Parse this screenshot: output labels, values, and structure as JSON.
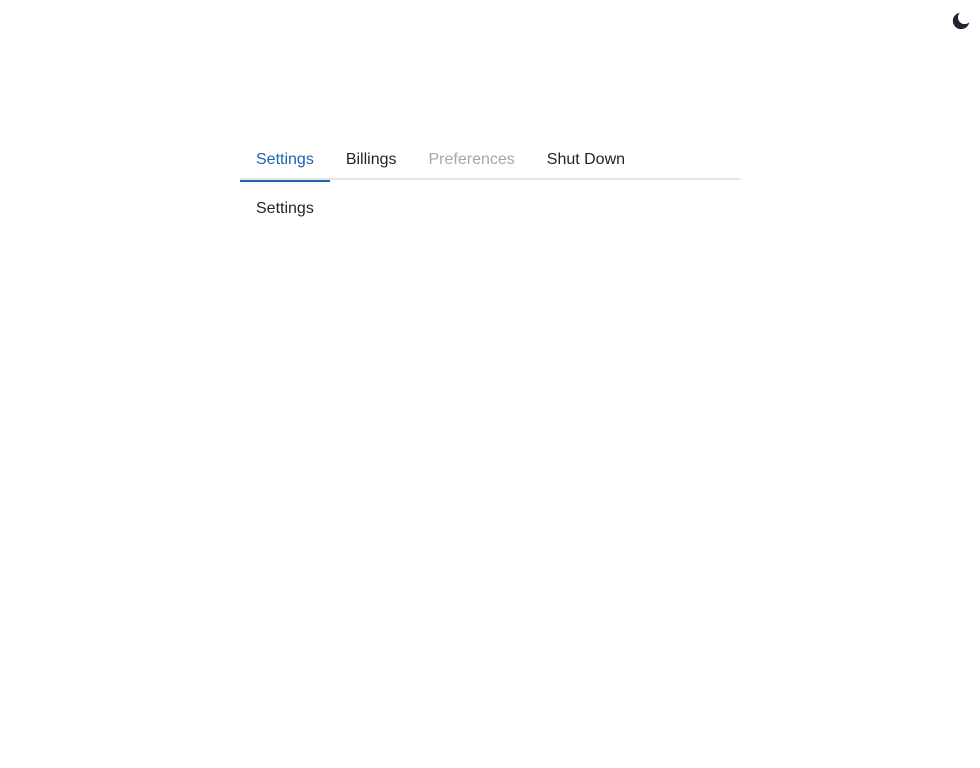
{
  "theme_toggle": {
    "icon": "moon-icon",
    "color": "#1f2433"
  },
  "tabs": [
    {
      "label": "Settings",
      "state": "active"
    },
    {
      "label": "Billings",
      "state": "normal"
    },
    {
      "label": "Preferences",
      "state": "disabled"
    },
    {
      "label": "Shut Down",
      "state": "normal"
    }
  ],
  "panel": {
    "content": "Settings"
  },
  "colors": {
    "accent": "#1c63b0",
    "text": "#1f2329",
    "disabled": "#a4a7ad",
    "divider": "#e3e5e8"
  }
}
